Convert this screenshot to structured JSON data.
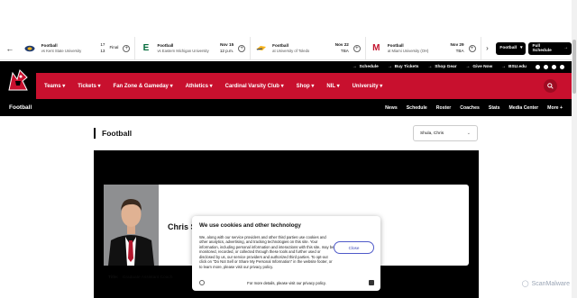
{
  "colors": {
    "brand_red": "#c8102e",
    "black": "#000000",
    "close_blue": "#3a46b7"
  },
  "scoreboard": {
    "prev_icon": "arrow-left-icon",
    "games": [
      {
        "title": "Football",
        "opponent": "vs Kent State University",
        "scores": [
          "17",
          "13"
        ],
        "status": "Final"
      },
      {
        "title": "Football",
        "opponent": "vs Eastern Michigan University",
        "date": "Nov 15",
        "time": "12 p.m."
      },
      {
        "title": "Football",
        "opponent": "at University of Toledo",
        "date": "Nov 22",
        "time": "TBA"
      },
      {
        "title": "Football",
        "opponent": "at Miami University (OH)",
        "date": "Nov 29",
        "time": "TBA"
      }
    ],
    "next_icon": "chevron-right-icon",
    "sport_button": "Football",
    "schedule_button": "Full Schedule"
  },
  "utility": {
    "links": [
      "Schedule",
      "Buy Tickets",
      "Shop Gear",
      "Give Now",
      "BSU.edu"
    ]
  },
  "main_nav": {
    "items": [
      "Teams",
      "Tickets",
      "Fan Zone & Gameday",
      "Athletics",
      "Cardinal Varsity Club",
      "Shop",
      "NIL",
      "University"
    ]
  },
  "sub_nav": {
    "brand": "Football",
    "links": [
      "News",
      "Schedule",
      "Roster",
      "Coaches",
      "Stats",
      "Media Center",
      "More +"
    ]
  },
  "page": {
    "heading": "Football",
    "selector_value": "Shula, Chris",
    "coach_name": "Chris S",
    "title_label": "Title:",
    "title_value": "Graduate Assistant Coach"
  },
  "cookie": {
    "heading": "We use cookies and other technology",
    "body": "We, along with our service providers and other third parties use cookies and other analytics, advertising, and tracking technologies on this site. Your information, including personal information and interactions with this site, may be monitored, recorded, or collected through these tools and further used or disclosed by us, our service providers and authorized third parties. To opt-out click on \"Do Not Sell or Share My Personal Information\" in the website footer, or to learn more, please visit our privacy policy.",
    "close_label": "Close",
    "footer_text": "For more details, please visit our privacy policy."
  },
  "watermark": "ScanMalware"
}
